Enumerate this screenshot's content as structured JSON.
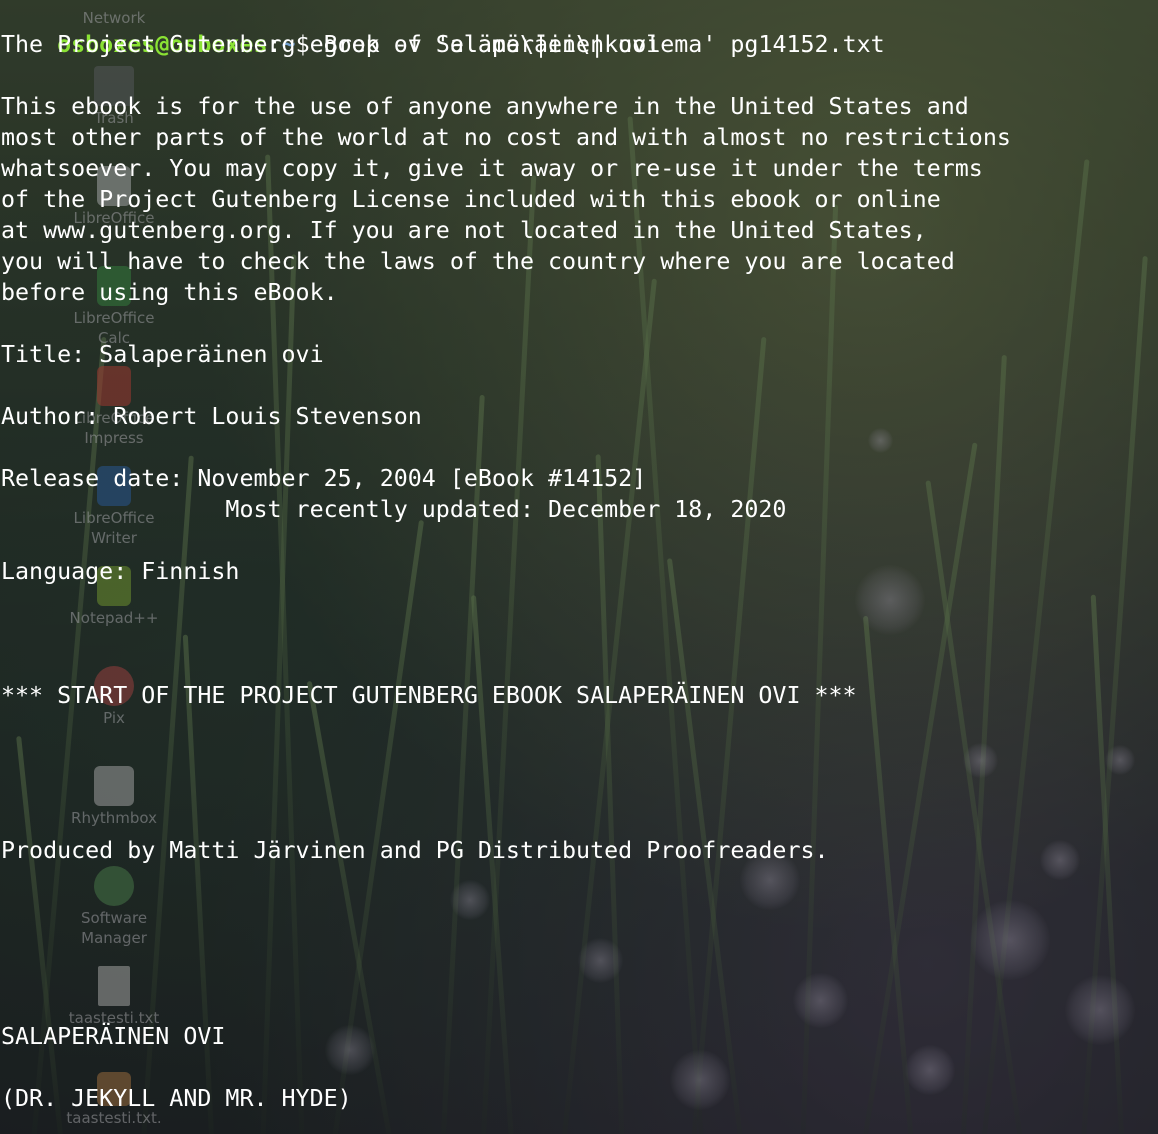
{
  "terminal": {
    "prompt": {
      "user_host": "osboxes@osboxes",
      "colon": ":",
      "path": "~",
      "symbol": "$ ",
      "command": "grep -v 'elämä\\|ei\\|kuolema' pg14152.txt"
    },
    "output_lines": [
      "The Project Gutenberg eBook of Salaperäinen ovi",
      "",
      "This ebook is for the use of anyone anywhere in the United States and",
      "most other parts of the world at no cost and with almost no restrictions",
      "whatsoever. You may copy it, give it away or re-use it under the terms",
      "of the Project Gutenberg License included with this ebook or online",
      "at www.gutenberg.org. If you are not located in the United States,",
      "you will have to check the laws of the country where you are located",
      "before using this eBook.",
      "",
      "Title: Salaperäinen ovi",
      "",
      "Author: Robert Louis Stevenson",
      "",
      "Release date: November 25, 2004 [eBook #14152]",
      "                Most recently updated: December 18, 2020",
      "",
      "Language: Finnish",
      "",
      "",
      "",
      "*** START OF THE PROJECT GUTENBERG EBOOK SALAPERÄINEN OVI ***",
      "",
      "",
      "",
      "",
      "Produced by Matti Järvinen and PG Distributed Proofreaders.",
      "",
      "",
      "",
      "",
      "",
      "SALAPERÄINEN OVI",
      "",
      "(DR. JEKYLL AND MR. HYDE)"
    ]
  },
  "desktop": {
    "icons": [
      {
        "label": "Network",
        "icon": "network-icon"
      },
      {
        "label": "Trash",
        "icon": "trash-icon"
      },
      {
        "label": "LibreOffice",
        "icon": "libreoffice-icon"
      },
      {
        "label": "LibreOffice Calc",
        "icon": "libreoffice-calc-icon"
      },
      {
        "label": "LibreOffice Impress",
        "icon": "libreoffice-impress-icon"
      },
      {
        "label": "LibreOffice Writer",
        "icon": "libreoffice-writer-icon"
      },
      {
        "label": "Notepad++",
        "icon": "notepad-plus-plus-icon"
      },
      {
        "label": "Pix",
        "icon": "pix-icon"
      },
      {
        "label": "Rhythmbox",
        "icon": "rhythmbox-icon"
      },
      {
        "label": "Software Manager",
        "icon": "software-manager-icon"
      },
      {
        "label": "taastesti.txt",
        "icon": "text-file-icon"
      },
      {
        "label": "taastesti.txt.",
        "icon": "archive-file-icon"
      }
    ]
  },
  "colors": {
    "prompt_user": "#8ae234",
    "prompt_path": "#729fcf",
    "text": "#ffffff"
  }
}
